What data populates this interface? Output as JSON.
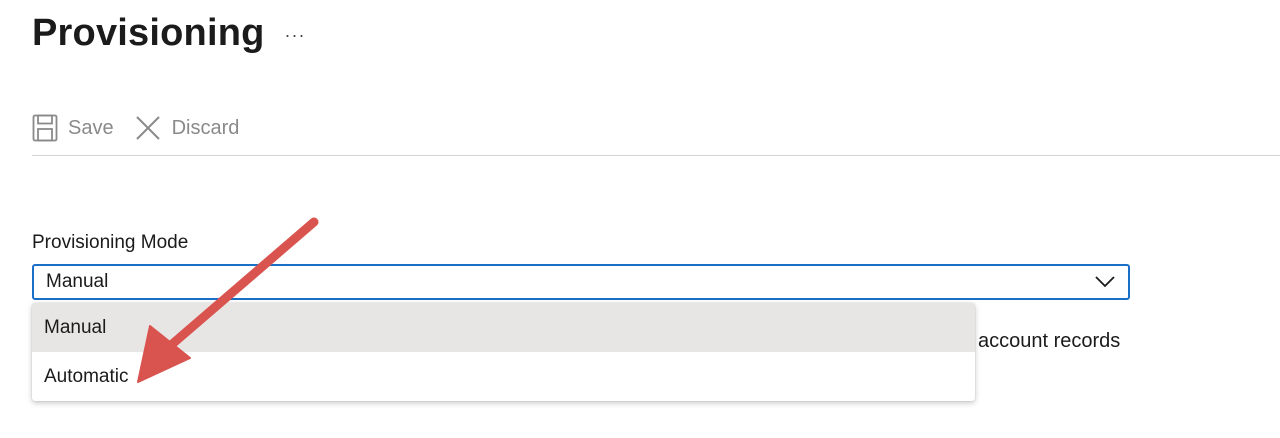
{
  "page": {
    "title": "Provisioning",
    "more_label": "···"
  },
  "toolbar": {
    "save_label": "Save",
    "discard_label": "Discard"
  },
  "provisioning_mode": {
    "label": "Provisioning Mode",
    "selected": "Manual",
    "options": [
      "Manual",
      "Automatic"
    ]
  },
  "partial_text": "account records",
  "colors": {
    "focus_border": "#1a6fc6",
    "selected_option_bg": "#e8e6e5",
    "annotation_arrow": "#d9534f",
    "disabled_toolbar": "#8a8a8a"
  },
  "icons": {
    "save": "save-icon",
    "discard": "close-icon",
    "chevron": "chevron-down-icon"
  }
}
